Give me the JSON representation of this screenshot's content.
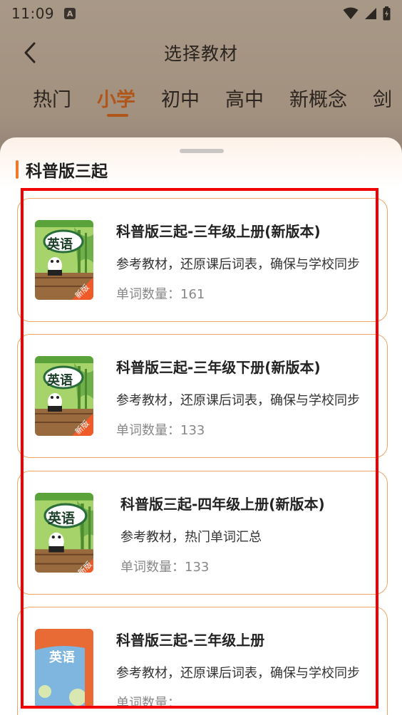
{
  "status_bar": {
    "time": "11:09",
    "notification_badge": "A"
  },
  "header": {
    "title": "选择教材"
  },
  "tabs": [
    {
      "label": "热门",
      "active": false
    },
    {
      "label": "小学",
      "active": true
    },
    {
      "label": "初中",
      "active": false
    },
    {
      "label": "高中",
      "active": false
    },
    {
      "label": "新概念",
      "active": false
    },
    {
      "label": "剑",
      "active": false
    }
  ],
  "sheet": {
    "section_title": "科普版三起",
    "books": [
      {
        "title": "科普版三起-三年级上册(新版本)",
        "description": "参考教材，还原课后词表，确保与学校同步",
        "count_label": "单词数量：",
        "count": "161",
        "cover_text": "英语",
        "cover_badge": "新版",
        "cover_style": "green"
      },
      {
        "title": "科普版三起-三年级下册(新版本)",
        "description": "参考教材，还原课后词表，确保与学校同步",
        "count_label": "单词数量：",
        "count": "133",
        "cover_text": "英语",
        "cover_badge": "新版",
        "cover_style": "green"
      },
      {
        "title": "科普版三起-四年级上册(新版本)",
        "description": "参考教材，热门单词汇总",
        "count_label": "单词数量：",
        "count": "133",
        "cover_text": "英语",
        "cover_badge": "新版",
        "cover_style": "green"
      },
      {
        "title": "科普版三起-三年级上册",
        "description": "参考教材，还原课后词表，确保与学校同步",
        "count_label": "单词数量：",
        "count": "",
        "cover_text": "英语",
        "cover_badge": "",
        "cover_style": "blue"
      }
    ]
  },
  "colors": {
    "accent": "#b0561a",
    "card_border": "#f4a366",
    "highlight_box": "#f20000",
    "section_bar": "#f07a2c"
  }
}
